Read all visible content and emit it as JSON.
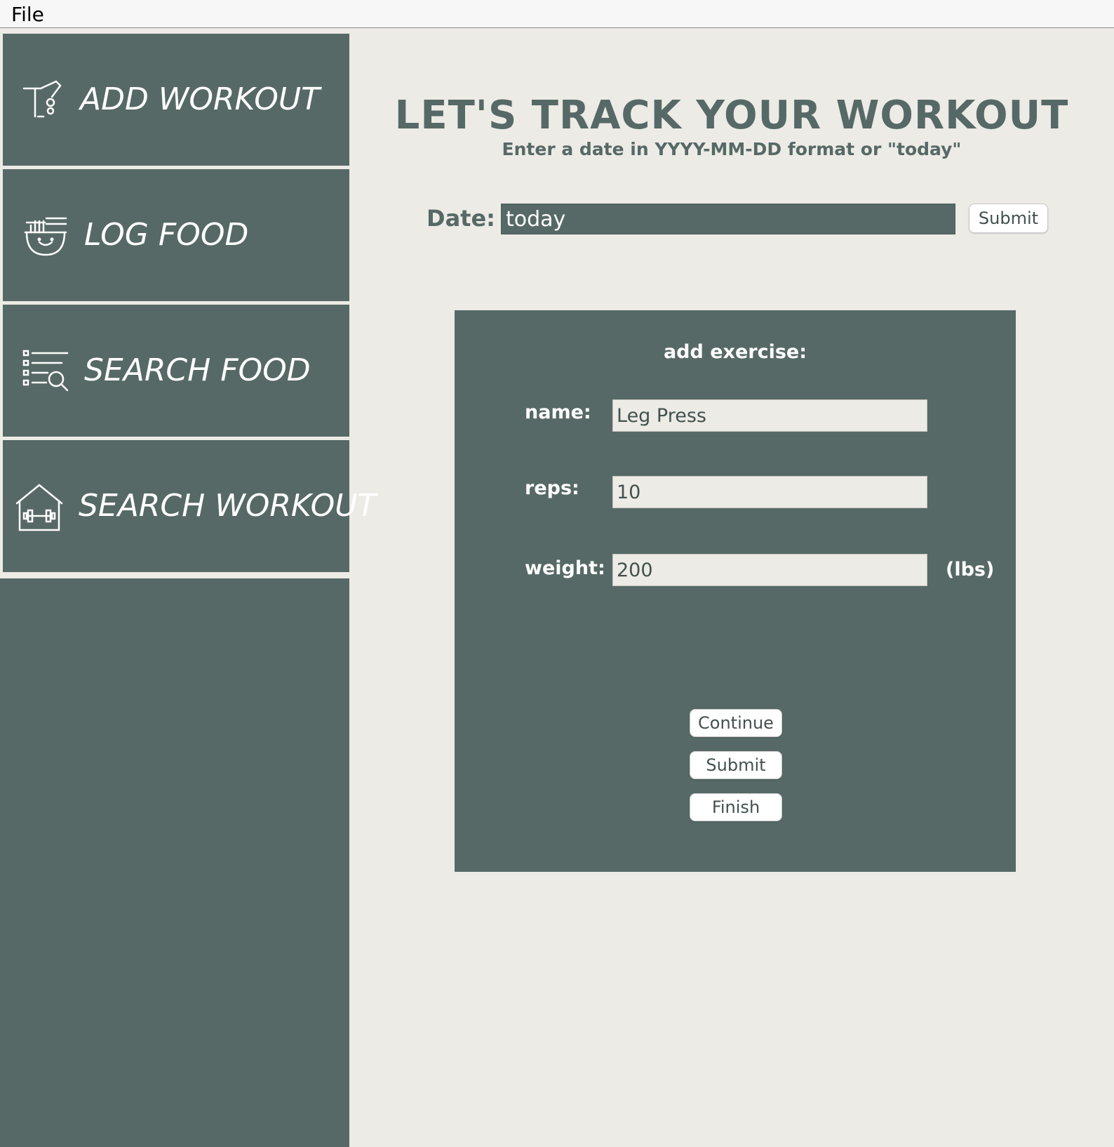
{
  "menubar": {
    "file_label": "File"
  },
  "sidebar": {
    "items": [
      {
        "label": "ADD WORKOUT",
        "icon": "treadmill-icon"
      },
      {
        "label": "LOG FOOD",
        "icon": "noodle-bowl-icon"
      },
      {
        "label": "SEARCH FOOD",
        "icon": "list-search-icon"
      },
      {
        "label": "SEARCH WORKOUT",
        "icon": "gym-house-icon"
      }
    ]
  },
  "main": {
    "title": "LET'S TRACK YOUR WORKOUT",
    "subtitle": "Enter a date in YYYY-MM-DD format or \"today\"",
    "date_label": "Date:",
    "date_value": "today",
    "submit_label": "Submit"
  },
  "panel": {
    "title": "add exercise:",
    "name_label": "name:",
    "name_value": "Leg Press",
    "reps_label": "reps:",
    "reps_value": "10",
    "weight_label": "weight:",
    "weight_value": "200",
    "weight_unit": "(lbs)",
    "continue_label": "Continue",
    "submit_label": "Submit",
    "finish_label": "Finish"
  },
  "colors": {
    "accent": "#566966",
    "background": "#edebe6",
    "text_on_accent": "#ffffff"
  }
}
